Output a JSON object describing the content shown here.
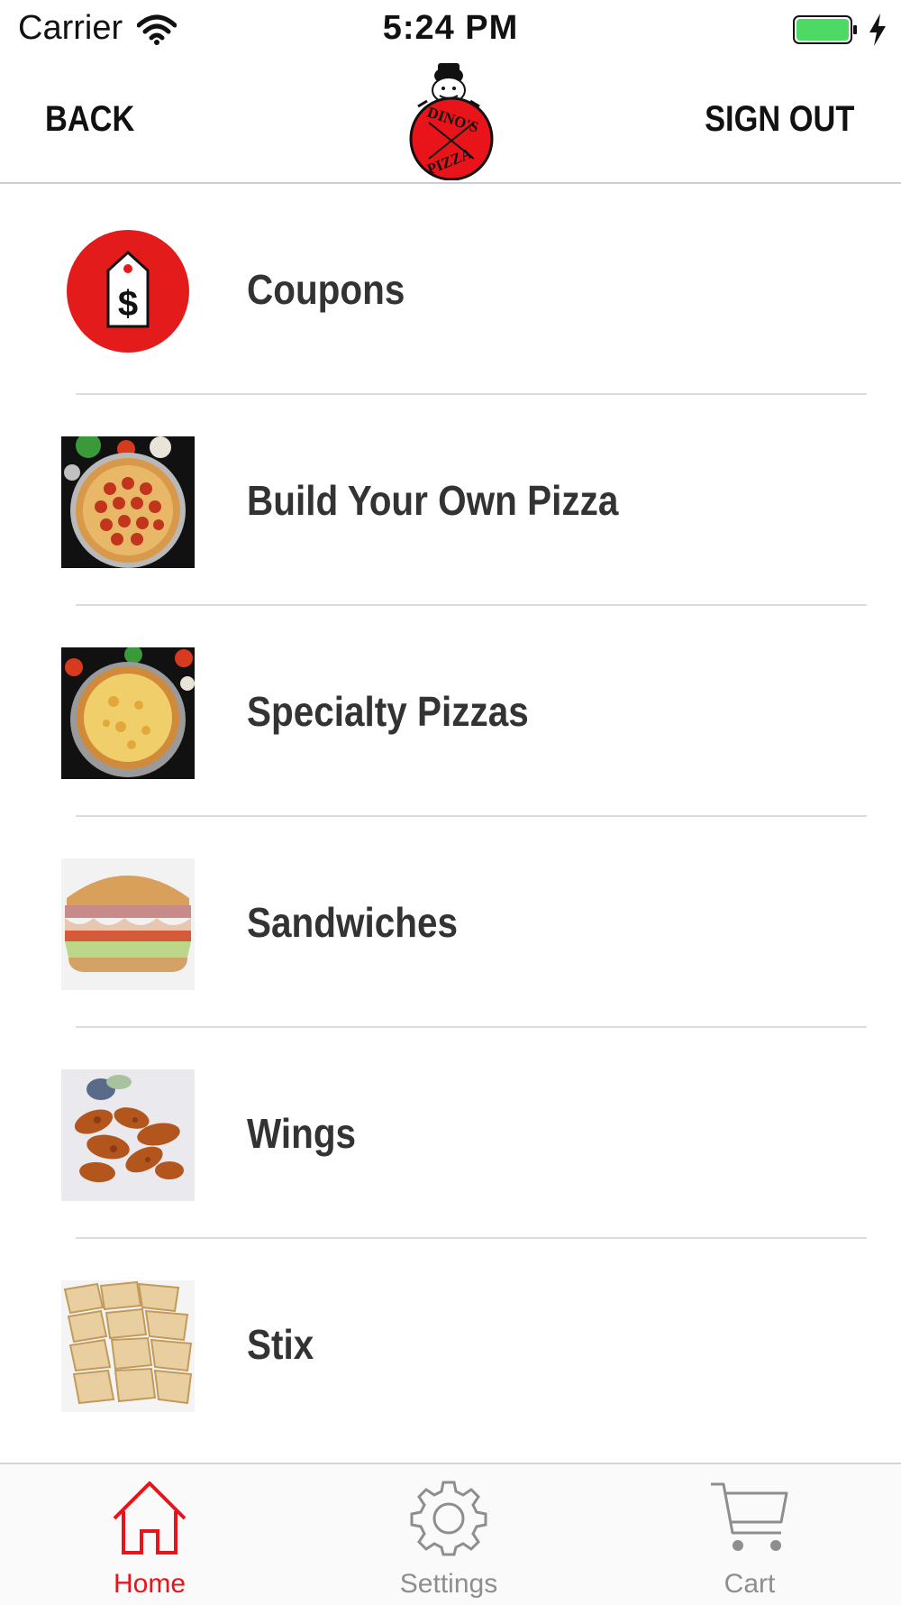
{
  "status_bar": {
    "carrier": "Carrier",
    "time": "5:24 PM",
    "battery_color": "#4cd964"
  },
  "nav": {
    "back_label": "BACK",
    "sign_out_label": "SIGN OUT",
    "logo_top_text": "DINO'S",
    "logo_bottom_text": "PIZZA"
  },
  "menu": {
    "items": [
      {
        "label": "Coupons",
        "icon": "coupon-tag-icon"
      },
      {
        "label": "Build Your Own Pizza",
        "icon": "pepperoni-pizza-image"
      },
      {
        "label": "Specialty Pizzas",
        "icon": "cheese-pizza-image"
      },
      {
        "label": "Sandwiches",
        "icon": "sandwich-image"
      },
      {
        "label": "Wings",
        "icon": "wings-image"
      },
      {
        "label": "Stix",
        "icon": "stix-image"
      }
    ]
  },
  "tabs": [
    {
      "label": "Home",
      "icon": "home-icon",
      "active": true
    },
    {
      "label": "Settings",
      "icon": "gear-icon",
      "active": false
    },
    {
      "label": "Cart",
      "icon": "cart-icon",
      "active": false
    }
  ],
  "colors": {
    "accent": "#e8141a",
    "inactive_tab": "#8e8e8e",
    "label_text": "#333333"
  }
}
